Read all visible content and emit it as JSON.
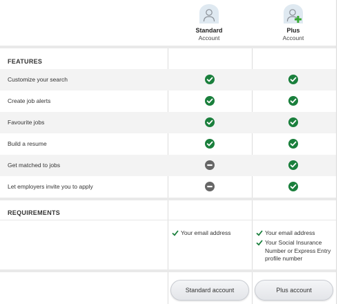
{
  "plans": [
    {
      "name": "Standard",
      "subtitle": "Account"
    },
    {
      "name": "Plus",
      "subtitle": "Account"
    }
  ],
  "features": {
    "title": "FEATURES",
    "rows": [
      {
        "label": "Customize your search",
        "standard": "check-icon",
        "plus": "check-icon"
      },
      {
        "label": "Create job alerts",
        "standard": "check-icon",
        "plus": "check-icon"
      },
      {
        "label": "Favourite jobs",
        "standard": "check-icon",
        "plus": "check-icon"
      },
      {
        "label": "Build a resume",
        "standard": "check-icon",
        "plus": "check-icon"
      },
      {
        "label": "Get matched to jobs",
        "standard": "minus-icon",
        "plus": "check-icon"
      },
      {
        "label": "Let employers invite you to apply",
        "standard": "minus-icon",
        "plus": "check-icon"
      }
    ]
  },
  "requirements": {
    "title": "REQUIREMENTS",
    "standard": [
      "Your email address"
    ],
    "plus": [
      "Your email address",
      "Your Social Insurance Number or Express Entry profile number"
    ]
  },
  "buttons": {
    "standard": "Standard account",
    "plus": "Plus account"
  },
  "colors": {
    "check": "#1a7f3c",
    "minus": "#666666",
    "plus_badge": "#3aa935",
    "avatar_bg": "#dfe9f1"
  }
}
